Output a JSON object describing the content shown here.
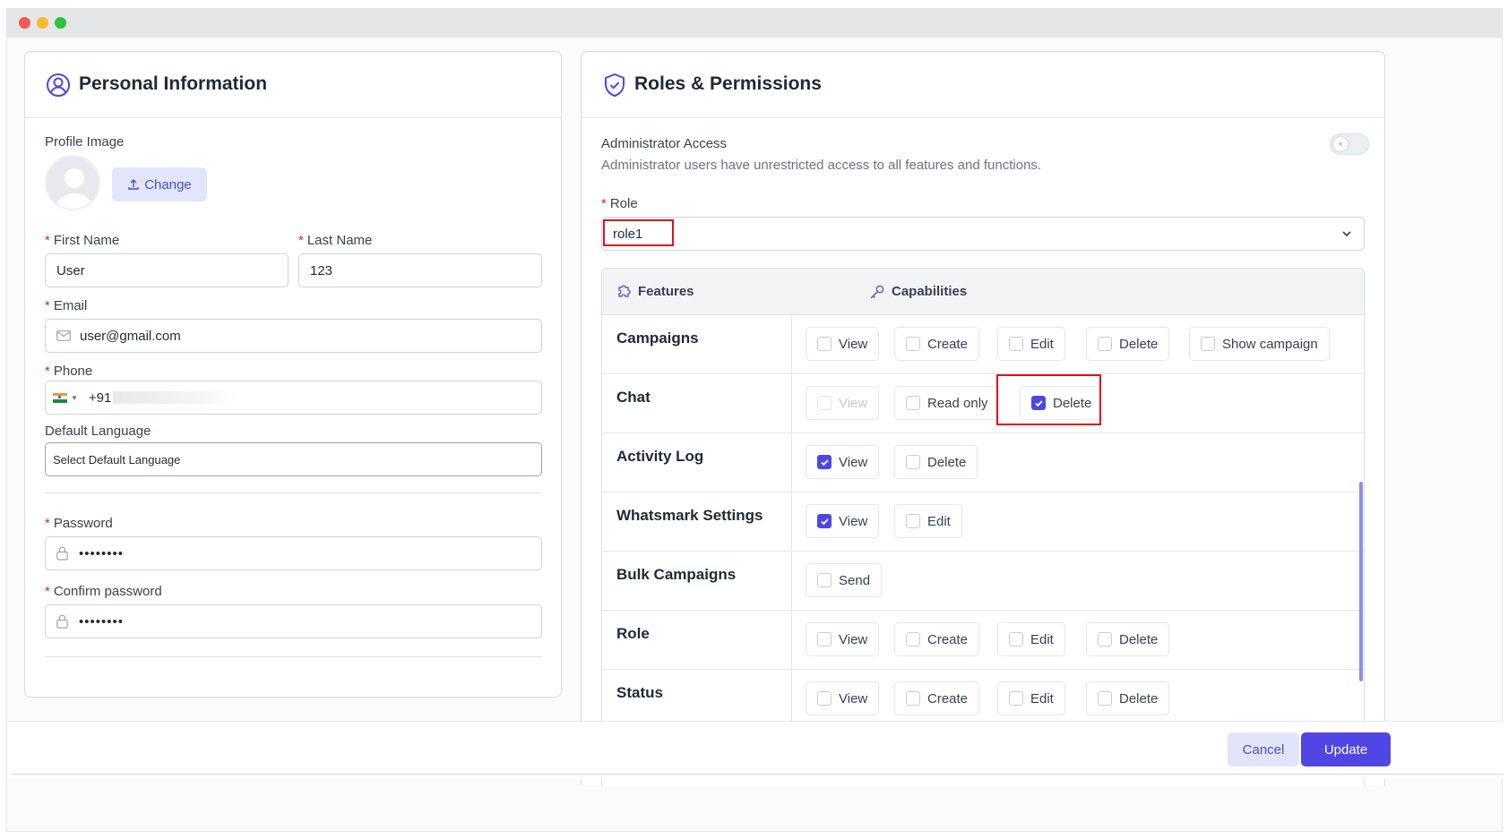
{
  "personal": {
    "title": "Personal Information",
    "profile_image_label": "Profile Image",
    "change_label": "Change",
    "first_name_label": "First Name",
    "first_name_value": "User",
    "last_name_label": "Last Name",
    "last_name_value": "123",
    "email_label": "Email",
    "email_value": "user@gmail.com",
    "phone_label": "Phone",
    "phone_prefix": "+91",
    "default_language_label": "Default Language",
    "default_language_value": "Select Default Language",
    "password_label": "Password",
    "password_value": "••••••••",
    "confirm_password_label": "Confirm password",
    "confirm_password_value": "••••••••",
    "required_mark": "*"
  },
  "roles": {
    "title": "Roles & Permissions",
    "admin_access_label": "Administrator Access",
    "admin_access_desc": "Administrator users have unrestricted access to all features and functions.",
    "admin_access_enabled": false,
    "role_label": "Role",
    "role_value": "role1",
    "features_header": "Features",
    "capabilities_header": "Capabilities",
    "rows": [
      {
        "feature": "Campaigns",
        "caps": [
          {
            "label": "View",
            "checked": false
          },
          {
            "label": "Create",
            "checked": false
          },
          {
            "label": "Edit",
            "checked": false
          },
          {
            "label": "Delete",
            "checked": false
          },
          {
            "label": "Show campaign",
            "checked": false
          }
        ]
      },
      {
        "feature": "Chat",
        "caps": [
          {
            "label": "View",
            "checked": false,
            "disabled": true
          },
          {
            "label": "Read only",
            "checked": false
          },
          {
            "label": "Delete",
            "checked": true
          }
        ]
      },
      {
        "feature": "Activity Log",
        "caps": [
          {
            "label": "View",
            "checked": true
          },
          {
            "label": "Delete",
            "checked": false
          }
        ]
      },
      {
        "feature": "Whatsmark Settings",
        "caps": [
          {
            "label": "View",
            "checked": true
          },
          {
            "label": "Edit",
            "checked": false
          }
        ]
      },
      {
        "feature": "Bulk Campaigns",
        "caps": [
          {
            "label": "Send",
            "checked": false
          }
        ]
      },
      {
        "feature": "Role",
        "caps": [
          {
            "label": "View",
            "checked": false
          },
          {
            "label": "Create",
            "checked": false
          },
          {
            "label": "Edit",
            "checked": false
          },
          {
            "label": "Delete",
            "checked": false
          }
        ]
      },
      {
        "feature": "Status",
        "caps": [
          {
            "label": "View",
            "checked": false
          },
          {
            "label": "Create",
            "checked": false
          },
          {
            "label": "Edit",
            "checked": false
          },
          {
            "label": "Delete",
            "checked": false
          }
        ]
      }
    ]
  },
  "footer": {
    "cancel_label": "Cancel",
    "update_label": "Update"
  },
  "colors": {
    "accent": "#4f46e5",
    "highlight": "#e0121b"
  }
}
